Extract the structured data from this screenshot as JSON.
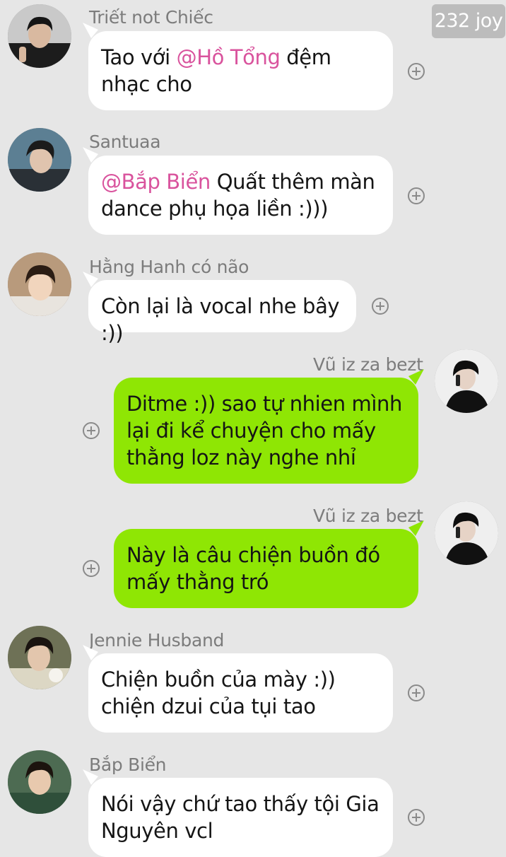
{
  "badge": {
    "text": "232 joy"
  },
  "messages": [
    {
      "sender": "Triết not Chiếc",
      "parts": [
        {
          "t": "Tao với ",
          "m": false
        },
        {
          "t": "@Hồ Tổng",
          "m": true
        },
        {
          "t": " đệm nhạc cho",
          "m": false
        }
      ]
    },
    {
      "sender": "Santuaa",
      "parts": [
        {
          "t": "@Bắp Biển",
          "m": true
        },
        {
          "t": " Quất thêm màn dance phụ họa liền :)))",
          "m": false
        }
      ]
    },
    {
      "sender": "Hằng Hanh có não",
      "parts": [
        {
          "t": "Còn lại là vocal nhe bây :))",
          "m": false
        }
      ]
    },
    {
      "sender": "Vũ iz za bezt",
      "parts": [
        {
          "t": "Ditme :)) sao tự nhien mình lại đi kể chuyện cho mấy thằng loz này nghe nhỉ",
          "m": false
        }
      ]
    },
    {
      "sender": "Vũ iz za bezt",
      "parts": [
        {
          "t": "Này là câu chiện buồn đó mấy thằng tró",
          "m": false
        }
      ]
    },
    {
      "sender": "Jennie Husband",
      "parts": [
        {
          "t": "Chiện buồn của mày :)) chiện dzui của tụi tao",
          "m": false
        }
      ]
    },
    {
      "sender": "Bắp Biển",
      "parts": [
        {
          "t": "Nói vậy chứ tao thấy tội Gia Nguyên vcl",
          "m": false
        }
      ]
    }
  ]
}
